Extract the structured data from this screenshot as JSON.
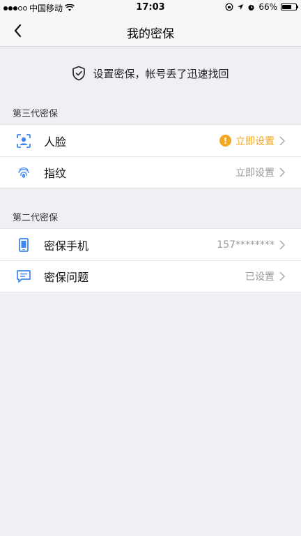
{
  "status_bar": {
    "carrier": "中国移动",
    "time": "17:03",
    "battery_percent": "66%",
    "battery_level": 0.66
  },
  "nav": {
    "title": "我的密保",
    "back_icon": "chevron-left-icon"
  },
  "banner": {
    "text": "设置密保，帐号丢了迅速找回",
    "icon": "shield-check-icon"
  },
  "sections": [
    {
      "title": "第三代密保",
      "items": [
        {
          "label": "人脸",
          "value": "立即设置",
          "icon": "face-scan-icon",
          "warning": true
        },
        {
          "label": "指纹",
          "value": "立即设置",
          "icon": "fingerprint-icon",
          "warning": false
        }
      ]
    },
    {
      "title": "第二代密保",
      "items": [
        {
          "label": "密保手机",
          "value": "157********",
          "icon": "phone-icon",
          "warning": false
        },
        {
          "label": "密保问题",
          "value": "已设置",
          "icon": "message-icon",
          "warning": false
        }
      ]
    }
  ],
  "colors": {
    "accent": "#3d85f0",
    "warning": "#f5a623",
    "background": "#efeff4"
  }
}
